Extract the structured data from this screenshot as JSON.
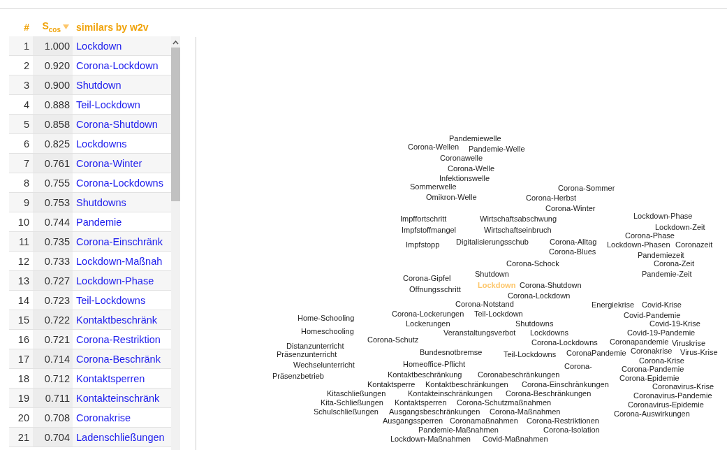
{
  "table": {
    "columns": [
      {
        "label": "#",
        "sorted": false
      },
      {
        "label": "S$_{cos}$",
        "sorted": true
      },
      {
        "label": "similars by w2v",
        "sorted": false
      }
    ],
    "rows": [
      {
        "rank": "1",
        "score": "1.000",
        "word": "Lockdown"
      },
      {
        "rank": "2",
        "score": "0.920",
        "word": "Corona-Lockdown"
      },
      {
        "rank": "3",
        "score": "0.900",
        "word": "Shutdown"
      },
      {
        "rank": "4",
        "score": "0.888",
        "word": "Teil-Lockdown"
      },
      {
        "rank": "5",
        "score": "0.858",
        "word": "Corona-Shutdown"
      },
      {
        "rank": "6",
        "score": "0.825",
        "word": "Lockdowns"
      },
      {
        "rank": "7",
        "score": "0.761",
        "word": "Corona-Winter"
      },
      {
        "rank": "8",
        "score": "0.755",
        "word": "Corona-Lockdowns"
      },
      {
        "rank": "9",
        "score": "0.753",
        "word": "Shutdowns"
      },
      {
        "rank": "10",
        "score": "0.744",
        "word": "Pandemie"
      },
      {
        "rank": "11",
        "score": "0.735",
        "word": "Corona-Einschränk"
      },
      {
        "rank": "12",
        "score": "0.733",
        "word": "Lockdown-Maßnah"
      },
      {
        "rank": "13",
        "score": "0.727",
        "word": "Lockdown-Phase"
      },
      {
        "rank": "14",
        "score": "0.723",
        "word": "Teil-Lockdowns"
      },
      {
        "rank": "15",
        "score": "0.722",
        "word": "Kontaktbeschränk"
      },
      {
        "rank": "16",
        "score": "0.721",
        "word": "Corona-Restriktion"
      },
      {
        "rank": "17",
        "score": "0.714",
        "word": "Corona-Beschränk"
      },
      {
        "rank": "18",
        "score": "0.712",
        "word": "Kontaktsperren"
      },
      {
        "rank": "19",
        "score": "0.711",
        "word": "Kontakteinschränk"
      },
      {
        "rank": "20",
        "score": "0.708",
        "word": "Coronakrise"
      },
      {
        "rank": "21",
        "score": "0.704",
        "word": "Ladenschließungen"
      }
    ]
  },
  "scatter": {
    "query": {
      "text": "Lockdown"
    },
    "labels": [
      {
        "text": "Pandemiewelle"
      },
      {
        "text": "Corona-Wellen"
      },
      {
        "text": "Pandemie-Welle"
      },
      {
        "text": "Coronawelle"
      },
      {
        "text": "Corona-Welle"
      },
      {
        "text": "Infektionswelle"
      },
      {
        "text": "Sommerwelle"
      },
      {
        "text": "Corona-Sommer"
      },
      {
        "text": "Omikron-Welle"
      },
      {
        "text": "Corona-Herbst"
      },
      {
        "text": "Corona-Winter"
      },
      {
        "text": "Impffortschritt"
      },
      {
        "text": "Wirtschaftsabschwung"
      },
      {
        "text": "Lockdown-Phase"
      },
      {
        "text": "Impfstoffmangel"
      },
      {
        "text": "Wirtschaftseinbruch"
      },
      {
        "text": "Lockdown-Zeit"
      },
      {
        "text": "Corona-Phase"
      },
      {
        "text": "Impfstopp"
      },
      {
        "text": "Digitalisierungsschub"
      },
      {
        "text": "Corona-Alltag"
      },
      {
        "text": "Lockdown-Phasen"
      },
      {
        "text": "Coronazeit"
      },
      {
        "text": "Corona-Blues"
      },
      {
        "text": "Pandemiezeit"
      },
      {
        "text": "Corona-Schock"
      },
      {
        "text": "Corona-Zeit"
      },
      {
        "text": "Corona-Gipfel"
      },
      {
        "text": "Shutdown"
      },
      {
        "text": "Pandemie-Zeit"
      },
      {
        "text": "Corona-Shutdown"
      },
      {
        "text": "Öffnungsschritt"
      },
      {
        "text": "Corona-Lockdown"
      },
      {
        "text": "Corona-Notstand"
      },
      {
        "text": "Energiekrise"
      },
      {
        "text": "Covid-Krise"
      },
      {
        "text": "Home-Schooling"
      },
      {
        "text": "Corona-Lockerungen"
      },
      {
        "text": "Teil-Lockdown"
      },
      {
        "text": "Covid-Pandemie"
      },
      {
        "text": "Lockerungen"
      },
      {
        "text": "Shutdowns"
      },
      {
        "text": "Covid-19-Krise"
      },
      {
        "text": "Homeschooling"
      },
      {
        "text": "Corona-Schutz"
      },
      {
        "text": "Veranstaltungsverbot"
      },
      {
        "text": "Lockdowns"
      },
      {
        "text": "Covid-19-Pandemie"
      },
      {
        "text": "Distanzunterricht"
      },
      {
        "text": "Corona-Lockdowns"
      },
      {
        "text": "Coronapandemie"
      },
      {
        "text": "Viruskrise"
      },
      {
        "text": "Präsenzunterricht"
      },
      {
        "text": "Bundesnotbremse"
      },
      {
        "text": "Teil-Lockdowns"
      },
      {
        "text": "CoronaPandemie"
      },
      {
        "text": "Coronakrise"
      },
      {
        "text": "Virus-Krise"
      },
      {
        "text": "Corona-Krise"
      },
      {
        "text": "Wechselunterricht"
      },
      {
        "text": "Homeoffice-Pflicht"
      },
      {
        "text": "Corona-"
      },
      {
        "text": "Corona-Pandemie"
      },
      {
        "text": "Präsenzbetrieb"
      },
      {
        "text": "Kontaktbeschränkung"
      },
      {
        "text": "Coronabeschränkungen"
      },
      {
        "text": "Corona-Epidemie"
      },
      {
        "text": "Kontaktsperre"
      },
      {
        "text": "Kontaktbeschränkungen"
      },
      {
        "text": "Corona-Einschränkungen"
      },
      {
        "text": "Coronavirus-Krise"
      },
      {
        "text": "Kitaschließungen"
      },
      {
        "text": "Kontakteinschränkungen"
      },
      {
        "text": "Corona-Beschränkungen"
      },
      {
        "text": "Coronavirus-Pandemie"
      },
      {
        "text": "Kita-Schließungen"
      },
      {
        "text": "Kontaktsperren"
      },
      {
        "text": "Corona-Schutzmaßnahmen"
      },
      {
        "text": "Coronavirus-Epidemie"
      },
      {
        "text": "Schulschließungen"
      },
      {
        "text": "Ausgangsbeschränkungen"
      },
      {
        "text": "Corona-Maßnahmen"
      },
      {
        "text": "Corona-Auswirkungen"
      },
      {
        "text": "Ausgangssperren"
      },
      {
        "text": "Coronamaßnahmen"
      },
      {
        "text": "Corona-Restriktionen"
      },
      {
        "text": "Pandemie-Maßnahmen"
      },
      {
        "text": "Corona-Isolation"
      },
      {
        "text": "Lockdown-Maßnahmen"
      },
      {
        "text": "Covid-Maßnahmen"
      }
    ]
  }
}
